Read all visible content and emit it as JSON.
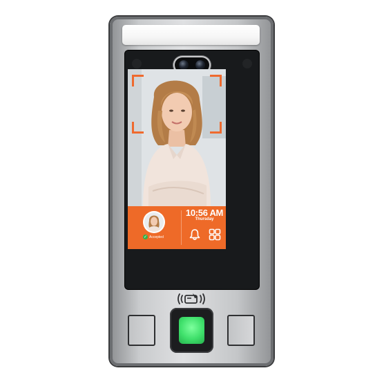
{
  "screen": {
    "time": "10:56 AM",
    "day": "Thursday",
    "status": "Accepted",
    "accent_color": "#ee6a28",
    "frame_color": "#ef6a2e",
    "accepted_color": "#33b24a"
  },
  "icons": {
    "bell": "bell-icon",
    "apps": "apps-grid-icon",
    "rfid": "rfid-card-icon",
    "fingerprint": "fingerprint-sensor",
    "check": "check-circle-icon"
  },
  "sensor_color": "#3fe06b"
}
